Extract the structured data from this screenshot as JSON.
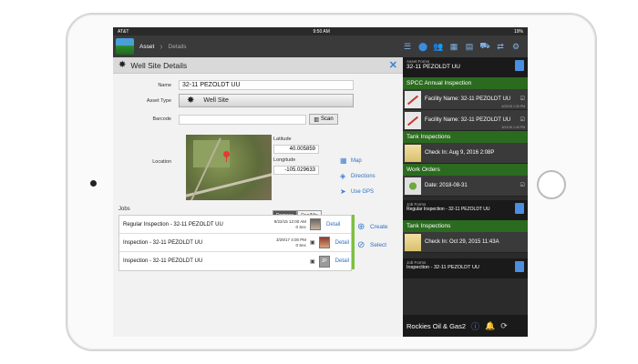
{
  "status": {
    "carrier": "AT&T",
    "time": "9:50 AM",
    "battery": "19%"
  },
  "nav": {
    "crumb_active": "Asset",
    "crumb_inactive": "Details"
  },
  "panel": {
    "title": "Well Site Details"
  },
  "form": {
    "name_label": "Name",
    "name_value": "32-11 PEZOLDT UU",
    "asset_type_label": "Asset Type",
    "asset_type_value": "Well Site",
    "barcode_label": "Barcode",
    "barcode_value": "",
    "scan_label": "Scan",
    "location_label": "Location",
    "latitude_label": "Latitude",
    "latitude_value": "40.005859",
    "longitude_label": "Longitude",
    "longitude_value": "-105.029633",
    "degrees_label": "Degrees",
    "degmin_label": "Deg/Min",
    "map_link": "Map",
    "directions_link": "Directions",
    "gps_link": "Use GPS"
  },
  "jobs": {
    "label": "Jobs",
    "create": "Create",
    "select": "Select",
    "rows": [
      {
        "name": "Regular Inspection  -  32-11 PEZOLDT UU",
        "date": "9/22/15 12:00 AM",
        "sub": "0 Sec",
        "detail": "Detail"
      },
      {
        "name": "Inspection  -  32-11 PEZOLDT UU",
        "date": "3/29/17 4:00 PM",
        "sub": "0 Sec",
        "detail": "Detail"
      },
      {
        "name": "Inspection  -  32-11 PEZOLDT UU",
        "date": "",
        "sub": "",
        "badge": "JP",
        "detail": "Detail"
      }
    ]
  },
  "right": {
    "asset_forms_small": "Asset Forms",
    "asset_forms_name": "32-11 PEZOLDT UU",
    "spcc": "SPCC Annual Inspection",
    "facility1": "Facility Name:  32-11 PEZOLDT UU",
    "facility1_meta": "4/23/15 1:30 PM",
    "facility2": "Facility Name:  32-11 PEZOLDT UU",
    "facility2_meta": "6/11/15 1:40 PM",
    "tank1": "Tank Inspections",
    "tank1_item": "Check In: Aug 9, 2016 2:08P",
    "work": "Work Orders",
    "work_item": "Date: 2018-08-31",
    "jobforms_small": "Job Forms",
    "jobforms_name1": "Regular Inspection  -  32-11 PEZOLDT UU",
    "tank2": "Tank Inspections",
    "tank2_item": "Check In: Oct 29, 2015 11:43A",
    "jobforms_small2": "Job Forms",
    "jobforms_name2": "Inspection  -  32-11 PEZOLDT UU",
    "brand": "Rockies Oil & Gas2"
  }
}
